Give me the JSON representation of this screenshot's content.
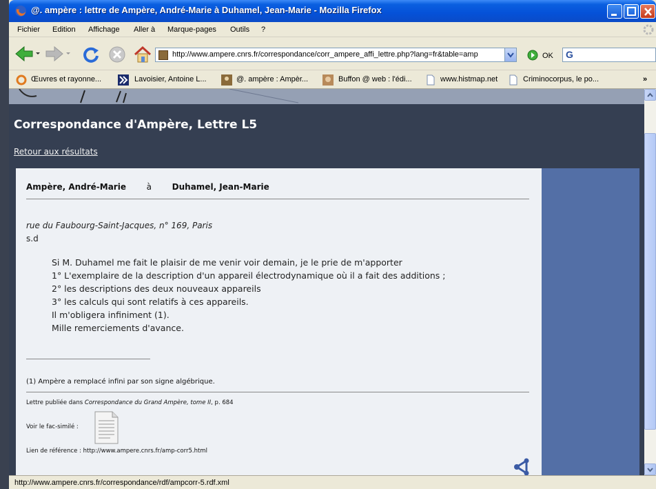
{
  "window": {
    "title": "@. ampère : lettre de Ampère, André-Marie à Duhamel, Jean-Marie - Mozilla Firefox"
  },
  "menu": [
    "Fichier",
    "Edition",
    "Affichage",
    "Aller à",
    "Marque-pages",
    "Outils",
    "?"
  ],
  "nav": {
    "url": "http://www.ampere.cnrs.fr/correspondance/corr_ampere_affi_lettre.php?lang=fr&table=amp",
    "go_label": "OK",
    "search_icon_letter": "G"
  },
  "bookmarks": [
    "Œuvres et rayonne...",
    "Lavoisier, Antoine L...",
    "@. ampère : Ampèr...",
    "Buffon @ web : l'édi...",
    "www.histmap.net",
    "Criminocorpus, le po..."
  ],
  "bookmarks_overflow": "»",
  "page": {
    "title": "Correspondance d'Ampère, Lettre L5",
    "back_link": "Retour aux résultats",
    "letter": {
      "author": "Ampère",
      "author_first": ", André-Marie",
      "to": "à",
      "recipient": "Duhamel",
      "recipient_first": ", Jean-Marie",
      "place": "rue du Faubourg-Saint-Jacques, n° 169, Paris",
      "date": "s.d",
      "lines": [
        "Si M. Duhamel me fait le plaisir de me venir voir demain, je le prie de m'apporter",
        "1° L'exemplaire de la description d'un appareil électrodynamique où il a fait des additions ;",
        "2°  les descriptions des deux nouveaux appareils",
        "3° les calculs qui sont relatifs à ces appareils.",
        "Il m'obligera infiniment (1).",
        "Mille remerciements d'avance."
      ],
      "note": "(1) Ampère a remplacé infini par son signe algébrique.",
      "pub_prefix": "Lettre publiée dans ",
      "pub_title": "Correspondance du Grand Ampère, tome II",
      "pub_suffix": ", p. 684",
      "facsimile_label": "Voir le fac-similé :",
      "ref_label": "Lien de référence : http://www.ampere.cnrs.fr/amp-corr5.html"
    }
  },
  "status": "http://www.ampere.cnrs.fr/correspondance/rdf/ampcorr-5.rdf.xml"
}
